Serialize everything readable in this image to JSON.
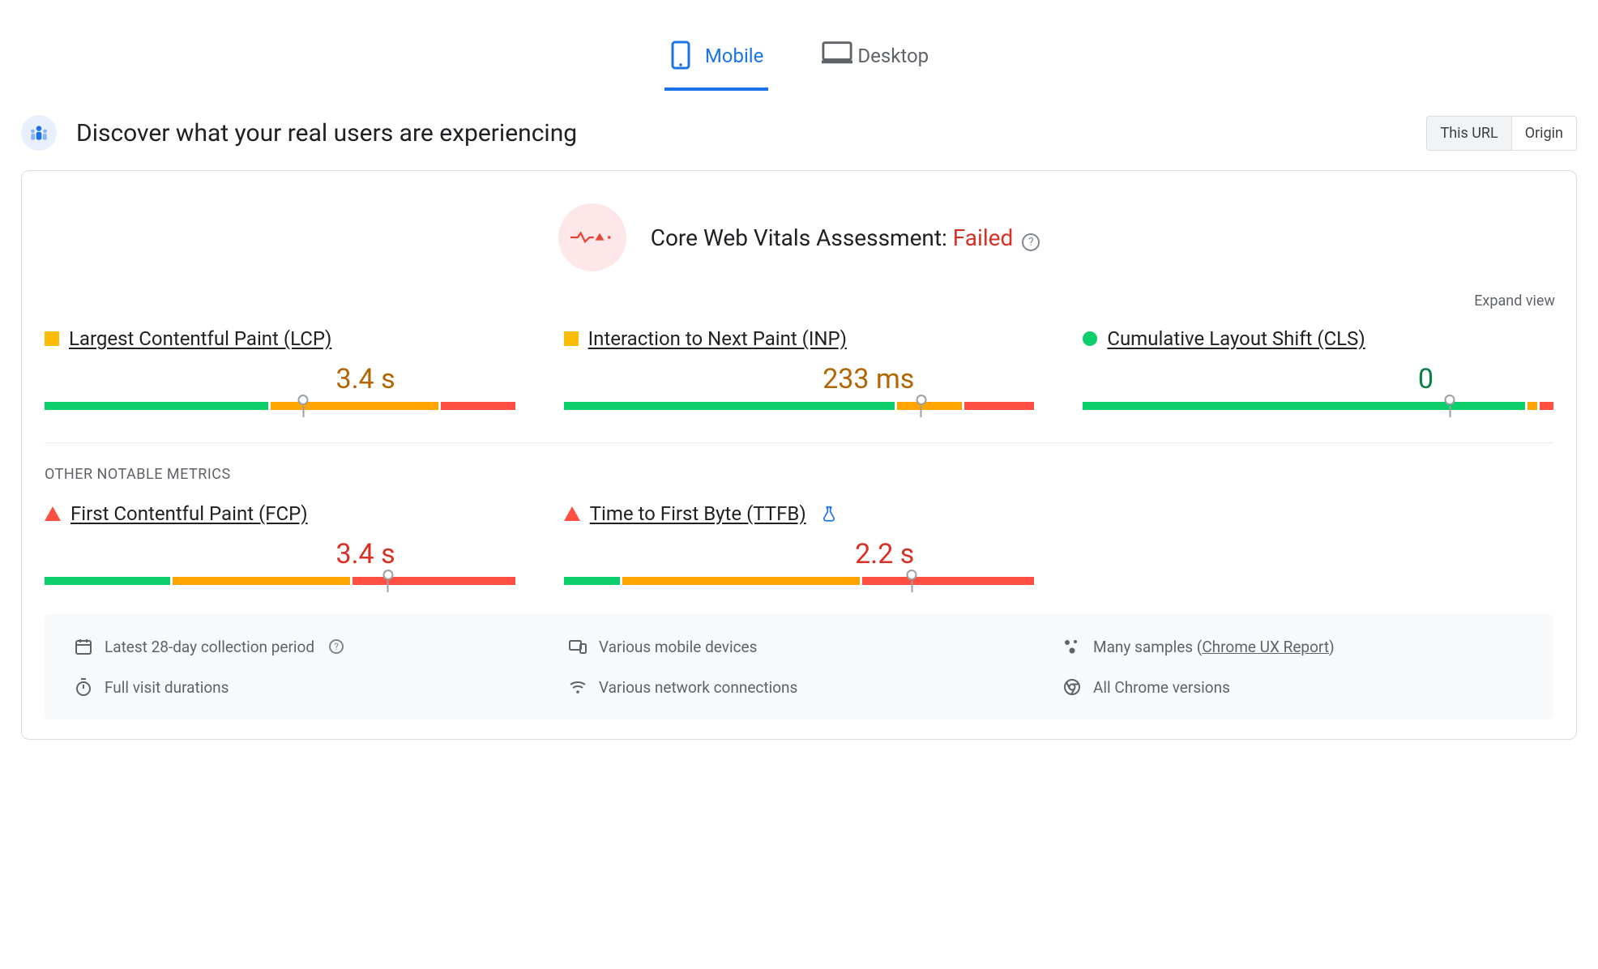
{
  "tabs": {
    "mobile": "Mobile",
    "desktop": "Desktop",
    "active": "mobile"
  },
  "header": {
    "title": "Discover what your real users are experiencing",
    "scope": {
      "this_url": "This URL",
      "origin": "Origin",
      "active": "this_url"
    }
  },
  "assessment": {
    "label": "Core Web Vitals Assessment:",
    "status": "Failed"
  },
  "expand_view": "Expand view",
  "section_other_label": "OTHER NOTABLE METRICS",
  "metrics": {
    "lcp": {
      "name": "Largest Contentful Paint (LCP)",
      "value": "3.4 s",
      "status": "orange",
      "segments": [
        48,
        36,
        16
      ],
      "marker": 55
    },
    "inp": {
      "name": "Interaction to Next Paint (INP)",
      "value": "233 ms",
      "status": "orange",
      "segments": [
        71,
        14,
        15
      ],
      "marker": 76
    },
    "cls": {
      "name": "Cumulative Layout Shift (CLS)",
      "value": "0",
      "status": "green",
      "segments": [
        95,
        2,
        3
      ],
      "marker": 78
    },
    "fcp": {
      "name": "First Contentful Paint (FCP)",
      "value": "3.4 s",
      "status": "red",
      "segments": [
        27,
        38,
        35
      ],
      "marker": 73
    },
    "ttfb": {
      "name": "Time to First Byte (TTFB)",
      "value": "2.2 s",
      "status": "red",
      "segments": [
        12,
        51,
        37
      ],
      "marker": 74,
      "experimental": true
    }
  },
  "info": {
    "period": "Latest 28-day collection period",
    "devices": "Various mobile devices",
    "samples_prefix": "Many samples (",
    "samples_link": "Chrome UX Report",
    "samples_suffix": ")",
    "durations": "Full visit durations",
    "networks": "Various network connections",
    "versions": "All Chrome versions"
  }
}
